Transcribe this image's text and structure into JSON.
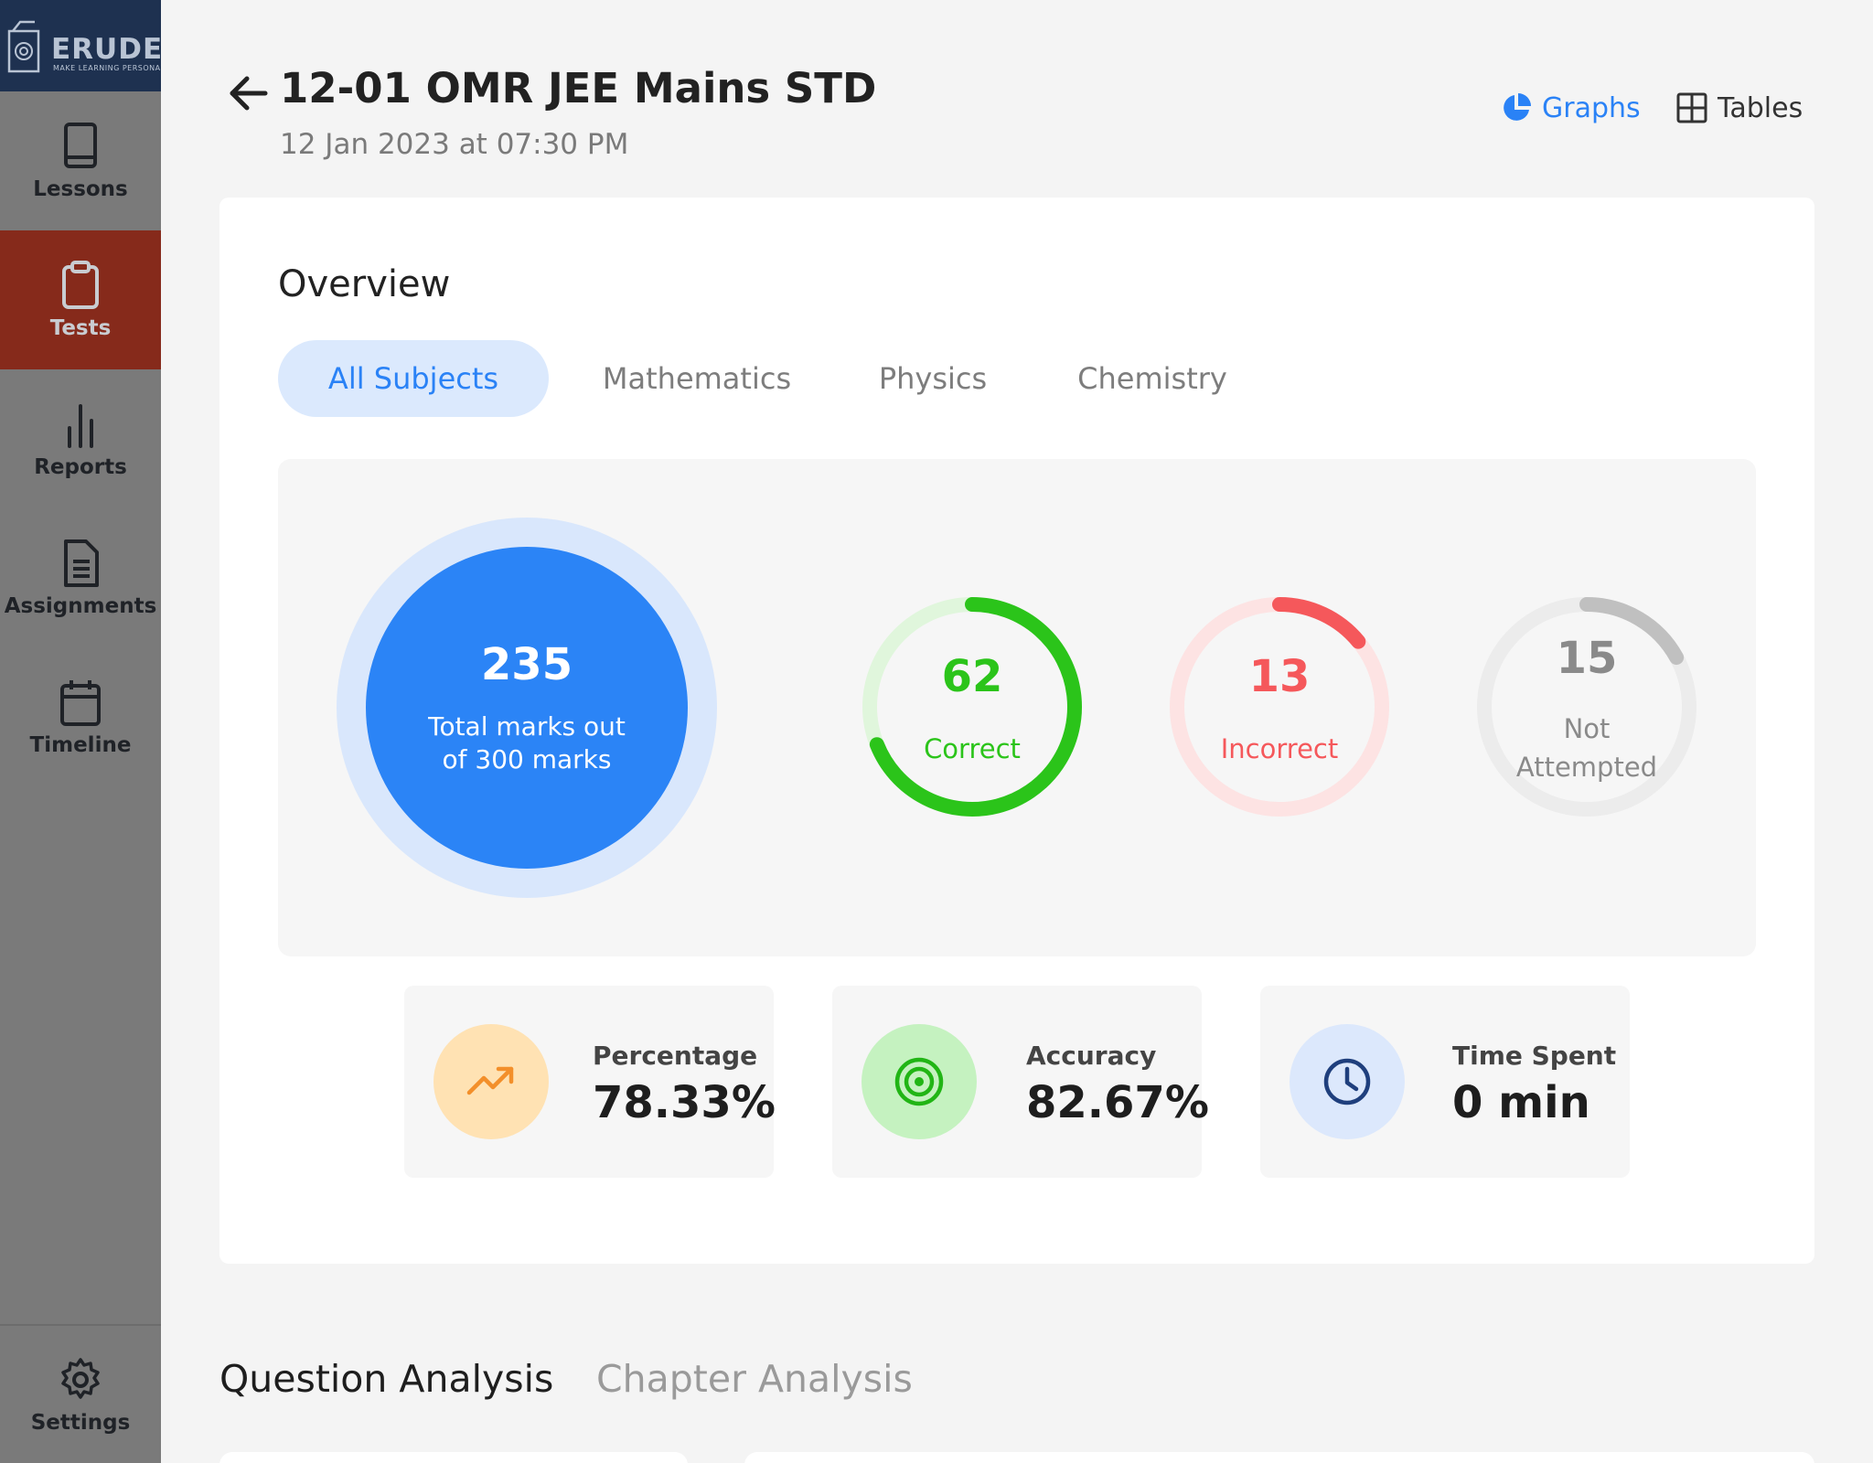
{
  "brand": {
    "name": "ERUDEX",
    "tagline": "MAKE LEARNING PERSONAL"
  },
  "sidebar": {
    "items": [
      {
        "label": "Lessons",
        "icon": "book-icon",
        "active": false
      },
      {
        "label": "Tests",
        "icon": "clipboard-icon",
        "active": true
      },
      {
        "label": "Reports",
        "icon": "bar-chart-icon",
        "active": false
      },
      {
        "label": "Assignments",
        "icon": "document-icon",
        "active": false
      },
      {
        "label": "Timeline",
        "icon": "calendar-icon",
        "active": false
      }
    ],
    "settings_label": "Settings"
  },
  "header": {
    "title": "12-01 OMR JEE Mains STD",
    "date": "12 Jan 2023 at 07:30 PM",
    "graphs_label": "Graphs",
    "tables_label": "Tables"
  },
  "overview": {
    "title": "Overview",
    "tabs": [
      {
        "label": "All Subjects",
        "active": true
      },
      {
        "label": "Mathematics",
        "active": false
      },
      {
        "label": "Physics",
        "active": false
      },
      {
        "label": "Chemistry",
        "active": false
      }
    ],
    "total": {
      "value": "235",
      "caption": "Total marks out of 300 marks"
    },
    "correct": {
      "value": "62",
      "label": "Correct",
      "fraction": 0.69,
      "color": "#2bc41a",
      "track": "#e0f6dc"
    },
    "incorrect": {
      "value": "13",
      "label": "Incorrect",
      "fraction": 0.14,
      "color": "#f5585b",
      "track": "#fde3e3"
    },
    "not_attempted": {
      "value": "15",
      "label": "Not Attempted",
      "fraction": 0.17,
      "color": "#c0c0c0",
      "track": "#ececec"
    },
    "metrics": [
      {
        "label": "Percentage",
        "value": "78.33%",
        "icon": "trending-up-icon",
        "bg": "#ffe2b3",
        "color": "#f38f2a"
      },
      {
        "label": "Accuracy",
        "value": "82.67%",
        "icon": "target-icon",
        "bg": "#c5f2c0",
        "color": "#21b515"
      },
      {
        "label": "Time Spent",
        "value": "0 min",
        "icon": "clock-icon",
        "bg": "#dce8fc",
        "color": "#1f3f7d"
      }
    ]
  },
  "analysis_tabs": [
    {
      "label": "Question Analysis",
      "active": true
    },
    {
      "label": "Chapter Analysis",
      "active": false
    }
  ]
}
